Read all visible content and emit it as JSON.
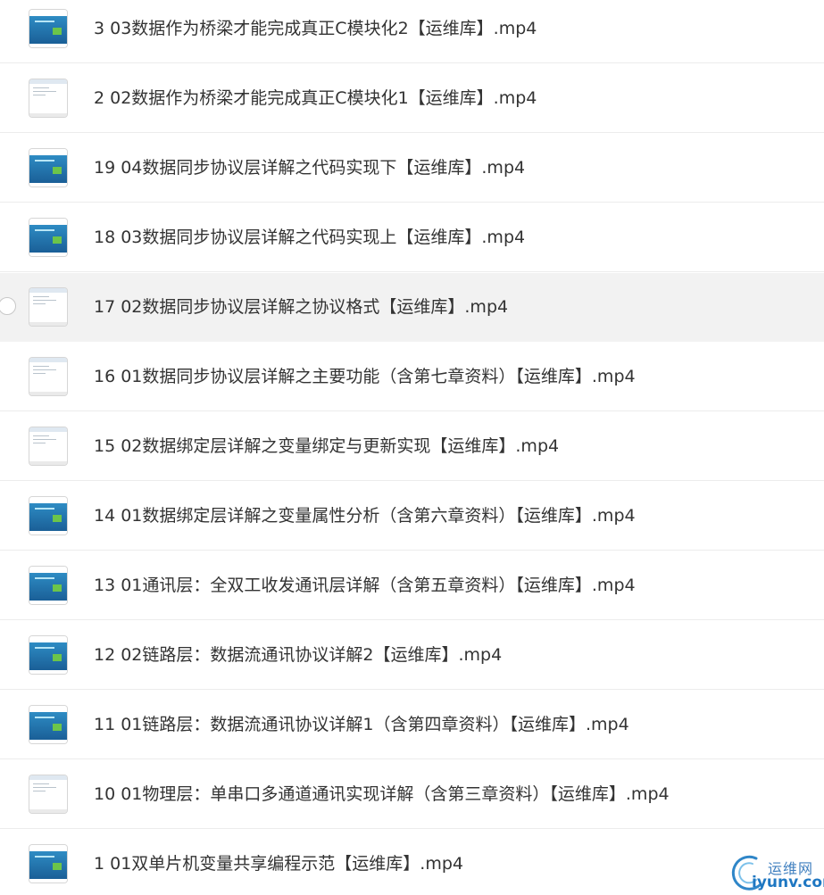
{
  "files": [
    {
      "name": "3 03数据作为桥梁才能完成真正C模块化2【运维库】.mp4",
      "thumb": "blue"
    },
    {
      "name": "2 02数据作为桥梁才能完成真正C模块化1【运维库】.mp4",
      "thumb": "white"
    },
    {
      "name": "19 04数据同步协议层详解之代码实现下【运维库】.mp4",
      "thumb": "blue"
    },
    {
      "name": "18 03数据同步协议层详解之代码实现上【运维库】.mp4",
      "thumb": "blue"
    },
    {
      "name": "17 02数据同步协议层详解之协议格式【运维库】.mp4",
      "thumb": "white",
      "hovered": true
    },
    {
      "name": "16 01数据同步协议层详解之主要功能（含第七章资料）【运维库】.mp4",
      "thumb": "white"
    },
    {
      "name": "15 02数据绑定层详解之变量绑定与更新实现【运维库】.mp4",
      "thumb": "white"
    },
    {
      "name": "14 01数据绑定层详解之变量属性分析（含第六章资料）【运维库】.mp4",
      "thumb": "blue"
    },
    {
      "name": "13 01通讯层：全双工收发通讯层详解（含第五章资料）【运维库】.mp4",
      "thumb": "blue"
    },
    {
      "name": "12 02链路层：数据流通讯协议详解2【运维库】.mp4",
      "thumb": "blue"
    },
    {
      "name": "11 01链路层：数据流通讯协议详解1（含第四章资料）【运维库】.mp4",
      "thumb": "blue"
    },
    {
      "name": "10 01物理层：单串口多通道通讯实现详解（含第三章资料）【运维库】.mp4",
      "thumb": "white"
    },
    {
      "name": "1 01双单片机变量共享编程示范【运维库】.mp4",
      "thumb": "blue"
    }
  ],
  "watermark": {
    "cn": "运维网",
    "en": "iyunv.com"
  }
}
